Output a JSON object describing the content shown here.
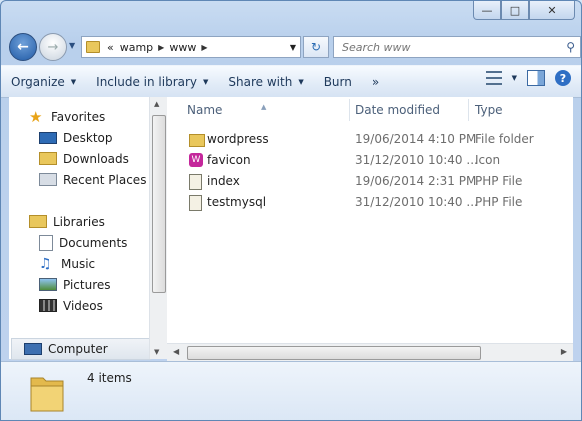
{
  "window": {
    "close_label": "✕",
    "max_label": "□",
    "min_label": "—"
  },
  "address": {
    "overflow": "«",
    "segments": [
      "wamp",
      "www"
    ],
    "search_placeholder": "Search www"
  },
  "toolbar": {
    "organize": "Organize",
    "include_in_library": "Include in library",
    "share_with": "Share with",
    "burn": "Burn",
    "more": "»"
  },
  "nav": {
    "favorites": "Favorites",
    "desktop": "Desktop",
    "downloads": "Downloads",
    "recent_places": "Recent Places",
    "libraries": "Libraries",
    "documents": "Documents",
    "music": "Music",
    "pictures": "Pictures",
    "videos": "Videos",
    "computer": "Computer"
  },
  "columns": {
    "name": "Name",
    "date": "Date modified",
    "type": "Type"
  },
  "files": [
    {
      "name": "wordpress",
      "date": "19/06/2014 4:10 PM",
      "type": "File folder",
      "icon": "folder-icon"
    },
    {
      "name": "favicon",
      "date": "31/12/2010 10:40 ...",
      "type": "Icon",
      "icon": "favicon-file-icon"
    },
    {
      "name": "index",
      "date": "19/06/2014 2:31 PM",
      "type": "PHP File",
      "icon": "php-file-icon"
    },
    {
      "name": "testmysql",
      "date": "31/12/2010 10:40 ...",
      "type": "PHP File",
      "icon": "php-file-icon"
    }
  ],
  "status": {
    "item_count": "4 items"
  },
  "colors": {
    "accent": "#1e395b",
    "folder": "#e9c75c"
  }
}
